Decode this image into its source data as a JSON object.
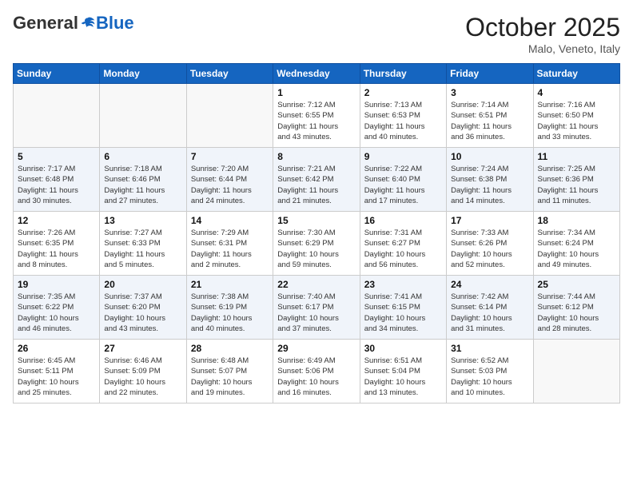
{
  "header": {
    "logo_general": "General",
    "logo_blue": "Blue",
    "month_title": "October 2025",
    "location": "Malo, Veneto, Italy"
  },
  "days_of_week": [
    "Sunday",
    "Monday",
    "Tuesday",
    "Wednesday",
    "Thursday",
    "Friday",
    "Saturday"
  ],
  "weeks": [
    [
      {
        "num": "",
        "detail": ""
      },
      {
        "num": "",
        "detail": ""
      },
      {
        "num": "",
        "detail": ""
      },
      {
        "num": "1",
        "detail": "Sunrise: 7:12 AM\nSunset: 6:55 PM\nDaylight: 11 hours\nand 43 minutes."
      },
      {
        "num": "2",
        "detail": "Sunrise: 7:13 AM\nSunset: 6:53 PM\nDaylight: 11 hours\nand 40 minutes."
      },
      {
        "num": "3",
        "detail": "Sunrise: 7:14 AM\nSunset: 6:51 PM\nDaylight: 11 hours\nand 36 minutes."
      },
      {
        "num": "4",
        "detail": "Sunrise: 7:16 AM\nSunset: 6:50 PM\nDaylight: 11 hours\nand 33 minutes."
      }
    ],
    [
      {
        "num": "5",
        "detail": "Sunrise: 7:17 AM\nSunset: 6:48 PM\nDaylight: 11 hours\nand 30 minutes."
      },
      {
        "num": "6",
        "detail": "Sunrise: 7:18 AM\nSunset: 6:46 PM\nDaylight: 11 hours\nand 27 minutes."
      },
      {
        "num": "7",
        "detail": "Sunrise: 7:20 AM\nSunset: 6:44 PM\nDaylight: 11 hours\nand 24 minutes."
      },
      {
        "num": "8",
        "detail": "Sunrise: 7:21 AM\nSunset: 6:42 PM\nDaylight: 11 hours\nand 21 minutes."
      },
      {
        "num": "9",
        "detail": "Sunrise: 7:22 AM\nSunset: 6:40 PM\nDaylight: 11 hours\nand 17 minutes."
      },
      {
        "num": "10",
        "detail": "Sunrise: 7:24 AM\nSunset: 6:38 PM\nDaylight: 11 hours\nand 14 minutes."
      },
      {
        "num": "11",
        "detail": "Sunrise: 7:25 AM\nSunset: 6:36 PM\nDaylight: 11 hours\nand 11 minutes."
      }
    ],
    [
      {
        "num": "12",
        "detail": "Sunrise: 7:26 AM\nSunset: 6:35 PM\nDaylight: 11 hours\nand 8 minutes."
      },
      {
        "num": "13",
        "detail": "Sunrise: 7:27 AM\nSunset: 6:33 PM\nDaylight: 11 hours\nand 5 minutes."
      },
      {
        "num": "14",
        "detail": "Sunrise: 7:29 AM\nSunset: 6:31 PM\nDaylight: 11 hours\nand 2 minutes."
      },
      {
        "num": "15",
        "detail": "Sunrise: 7:30 AM\nSunset: 6:29 PM\nDaylight: 10 hours\nand 59 minutes."
      },
      {
        "num": "16",
        "detail": "Sunrise: 7:31 AM\nSunset: 6:27 PM\nDaylight: 10 hours\nand 56 minutes."
      },
      {
        "num": "17",
        "detail": "Sunrise: 7:33 AM\nSunset: 6:26 PM\nDaylight: 10 hours\nand 52 minutes."
      },
      {
        "num": "18",
        "detail": "Sunrise: 7:34 AM\nSunset: 6:24 PM\nDaylight: 10 hours\nand 49 minutes."
      }
    ],
    [
      {
        "num": "19",
        "detail": "Sunrise: 7:35 AM\nSunset: 6:22 PM\nDaylight: 10 hours\nand 46 minutes."
      },
      {
        "num": "20",
        "detail": "Sunrise: 7:37 AM\nSunset: 6:20 PM\nDaylight: 10 hours\nand 43 minutes."
      },
      {
        "num": "21",
        "detail": "Sunrise: 7:38 AM\nSunset: 6:19 PM\nDaylight: 10 hours\nand 40 minutes."
      },
      {
        "num": "22",
        "detail": "Sunrise: 7:40 AM\nSunset: 6:17 PM\nDaylight: 10 hours\nand 37 minutes."
      },
      {
        "num": "23",
        "detail": "Sunrise: 7:41 AM\nSunset: 6:15 PM\nDaylight: 10 hours\nand 34 minutes."
      },
      {
        "num": "24",
        "detail": "Sunrise: 7:42 AM\nSunset: 6:14 PM\nDaylight: 10 hours\nand 31 minutes."
      },
      {
        "num": "25",
        "detail": "Sunrise: 7:44 AM\nSunset: 6:12 PM\nDaylight: 10 hours\nand 28 minutes."
      }
    ],
    [
      {
        "num": "26",
        "detail": "Sunrise: 6:45 AM\nSunset: 5:11 PM\nDaylight: 10 hours\nand 25 minutes."
      },
      {
        "num": "27",
        "detail": "Sunrise: 6:46 AM\nSunset: 5:09 PM\nDaylight: 10 hours\nand 22 minutes."
      },
      {
        "num": "28",
        "detail": "Sunrise: 6:48 AM\nSunset: 5:07 PM\nDaylight: 10 hours\nand 19 minutes."
      },
      {
        "num": "29",
        "detail": "Sunrise: 6:49 AM\nSunset: 5:06 PM\nDaylight: 10 hours\nand 16 minutes."
      },
      {
        "num": "30",
        "detail": "Sunrise: 6:51 AM\nSunset: 5:04 PM\nDaylight: 10 hours\nand 13 minutes."
      },
      {
        "num": "31",
        "detail": "Sunrise: 6:52 AM\nSunset: 5:03 PM\nDaylight: 10 hours\nand 10 minutes."
      },
      {
        "num": "",
        "detail": ""
      }
    ]
  ]
}
